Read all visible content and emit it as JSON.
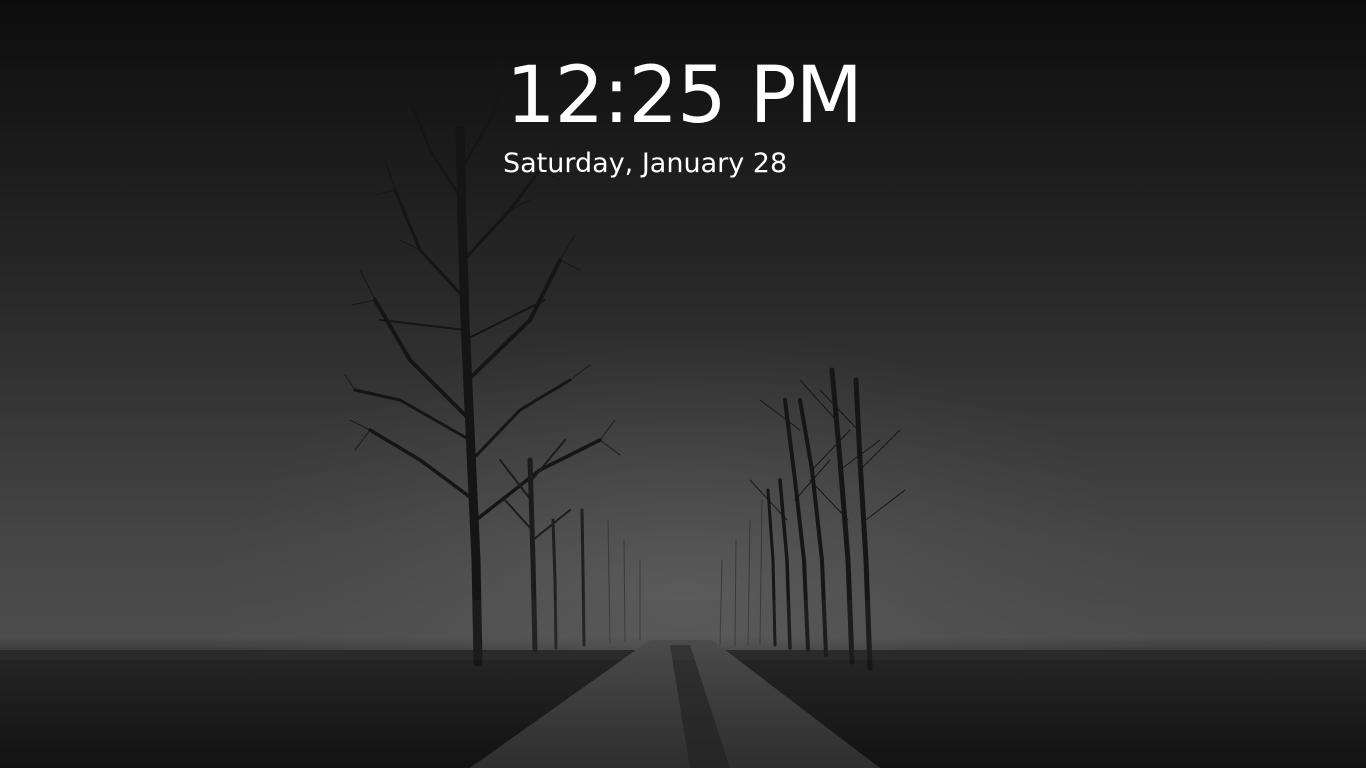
{
  "lock_screen": {
    "time": "12:25 PM",
    "date": "Saturday, January 28"
  },
  "wallpaper": {
    "subject": "foggy tree-lined road at night",
    "colors": {
      "sky_top": "#0e0e0e",
      "fog": "#4a4a4a",
      "ground": "#1c1c1c",
      "tree": "#141414"
    }
  }
}
